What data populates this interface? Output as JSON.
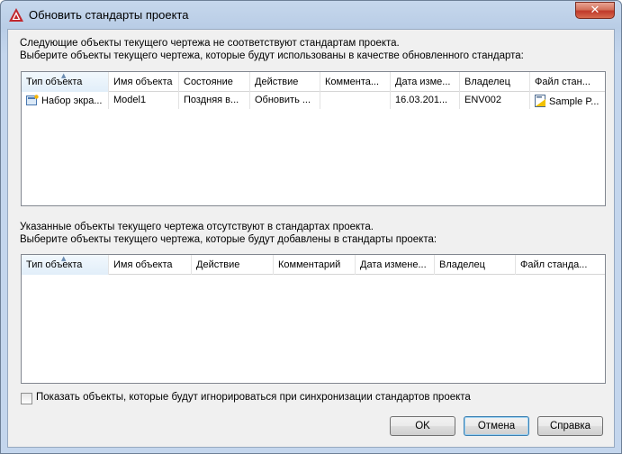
{
  "window": {
    "title": "Обновить стандарты проекта",
    "close_label": "✕"
  },
  "top_section": {
    "line1": "Следующие объекты текущего чертежа не соответствуют стандартам проекта.",
    "line2": "Выберите объекты текущего чертежа, которые будут использованы в качестве обновленного стандарта:",
    "columns": [
      "Тип объекта",
      "Имя объекта",
      "Состояние",
      "Действие",
      "Коммента...",
      "Дата изме...",
      "Владелец",
      "Файл стан..."
    ],
    "rows": [
      {
        "type": "Набор экра...",
        "name": "Model1",
        "state": "Поздняя в...",
        "action": "Обновить ...",
        "comment": "",
        "date": "16.03.201...",
        "owner": "ENV002",
        "file": "Sample P..."
      }
    ]
  },
  "bottom_section": {
    "line1": "Указанные объекты текущего чертежа отсутствуют в стандартах проекта.",
    "line2": "Выберите объекты текущего чертежа, которые будут добавлены в стандарты проекта:",
    "columns": [
      "Тип объекта",
      "Имя объекта",
      "Действие",
      "Комментарий",
      "Дата измене...",
      "Владелец",
      "Файл станда..."
    ],
    "rows": []
  },
  "checkbox": {
    "label": "Показать объекты, которые будут игнорироваться при синхронизации стандартов проекта",
    "checked": false
  },
  "buttons": {
    "ok": "OK",
    "cancel": "Отмена",
    "help": "Справка"
  },
  "colors": {
    "title_gradient": "#c4d6ed",
    "close_red": "#c0392b",
    "dialog_bg": "#f0f0f0",
    "sorted_header": "#e1eef9"
  },
  "icons": {
    "app": "autocad-logo-icon",
    "row_type": "screen-set-icon",
    "row_file": "standards-file-icon"
  }
}
